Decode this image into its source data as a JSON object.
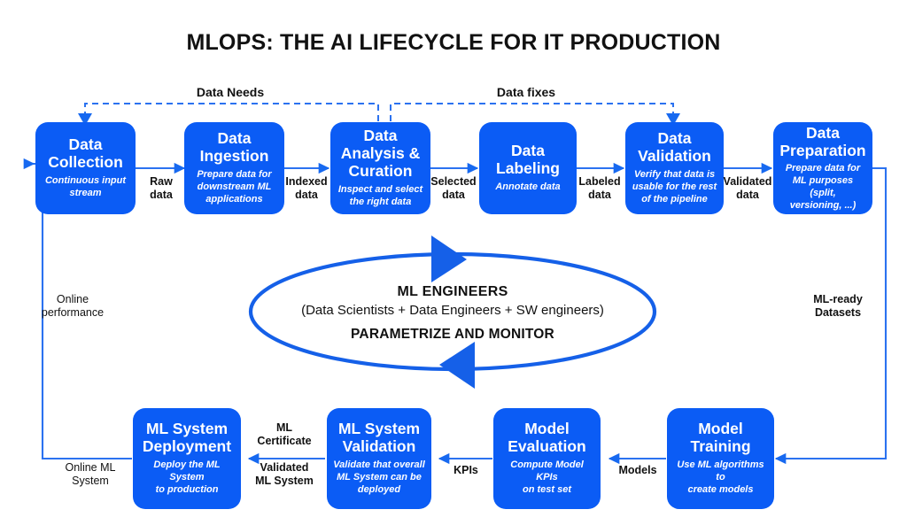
{
  "page": {
    "title": "MLOPS: THE AI LIFECYCLE FOR IT PRODUCTION",
    "accent_color": "#0B5CF5",
    "text_color": "#111111",
    "background_color": "#FFFFFF"
  },
  "top_row": [
    {
      "id": "data-collection",
      "title": "Data\nCollection",
      "subtitle": "Continuous input\nstream"
    },
    {
      "id": "data-ingestion",
      "title": "Data\nIngestion",
      "subtitle": "Prepare data for\ndownstream ML\napplications"
    },
    {
      "id": "data-analysis-curation",
      "title": "Data\nAnalysis &\nCuration",
      "subtitle": "Inspect and select\nthe right data"
    },
    {
      "id": "data-labeling",
      "title": "Data\nLabeling",
      "subtitle": "Annotate data"
    },
    {
      "id": "data-validation",
      "title": "Data\nValidation",
      "subtitle": "Verify that data is\nusable for the rest\nof the pipeline"
    },
    {
      "id": "data-preparation",
      "title": "Data\nPreparation",
      "subtitle": "Prepare data for\nML purposes (split,\nversioning, ...)"
    }
  ],
  "bottom_row": [
    {
      "id": "ml-system-deployment",
      "title": "ML System\nDeployment",
      "subtitle": "Deploy the ML System\nto production"
    },
    {
      "id": "ml-system-validation",
      "title": "ML System\nValidation",
      "subtitle": "Validate that overall\nML System can be\ndeployed"
    },
    {
      "id": "model-evaluation",
      "title": "Model\nEvaluation",
      "subtitle": "Compute Model KPIs\non test set"
    },
    {
      "id": "model-training",
      "title": "Model\nTraining",
      "subtitle": "Use ML algorithms to\ncreate models"
    }
  ],
  "edge_labels": {
    "raw_data": "Raw\ndata",
    "indexed_data": "Indexed\ndata",
    "selected_data": "Selected\ndata",
    "labeled_data": "Labeled\ndata",
    "validated_data": "Validated\ndata",
    "ml_ready_datasets": "ML-ready\nDatasets",
    "models": "Models",
    "kpis": "KPIs",
    "ml_certificate": "ML\nCertificate",
    "validated_ml_system": "Validated\nML System",
    "online_ml_system": "Online ML\nSystem",
    "online_performance": "Online\nperformance"
  },
  "feedback_loops": {
    "data_needs": "Data Needs",
    "data_fixes": "Data fixes"
  },
  "center": {
    "line1": "ML ENGINEERS",
    "line2": "(Data Scientists + Data Engineers + SW engineers)",
    "line3": "PARAMETRIZE AND MONITOR"
  }
}
